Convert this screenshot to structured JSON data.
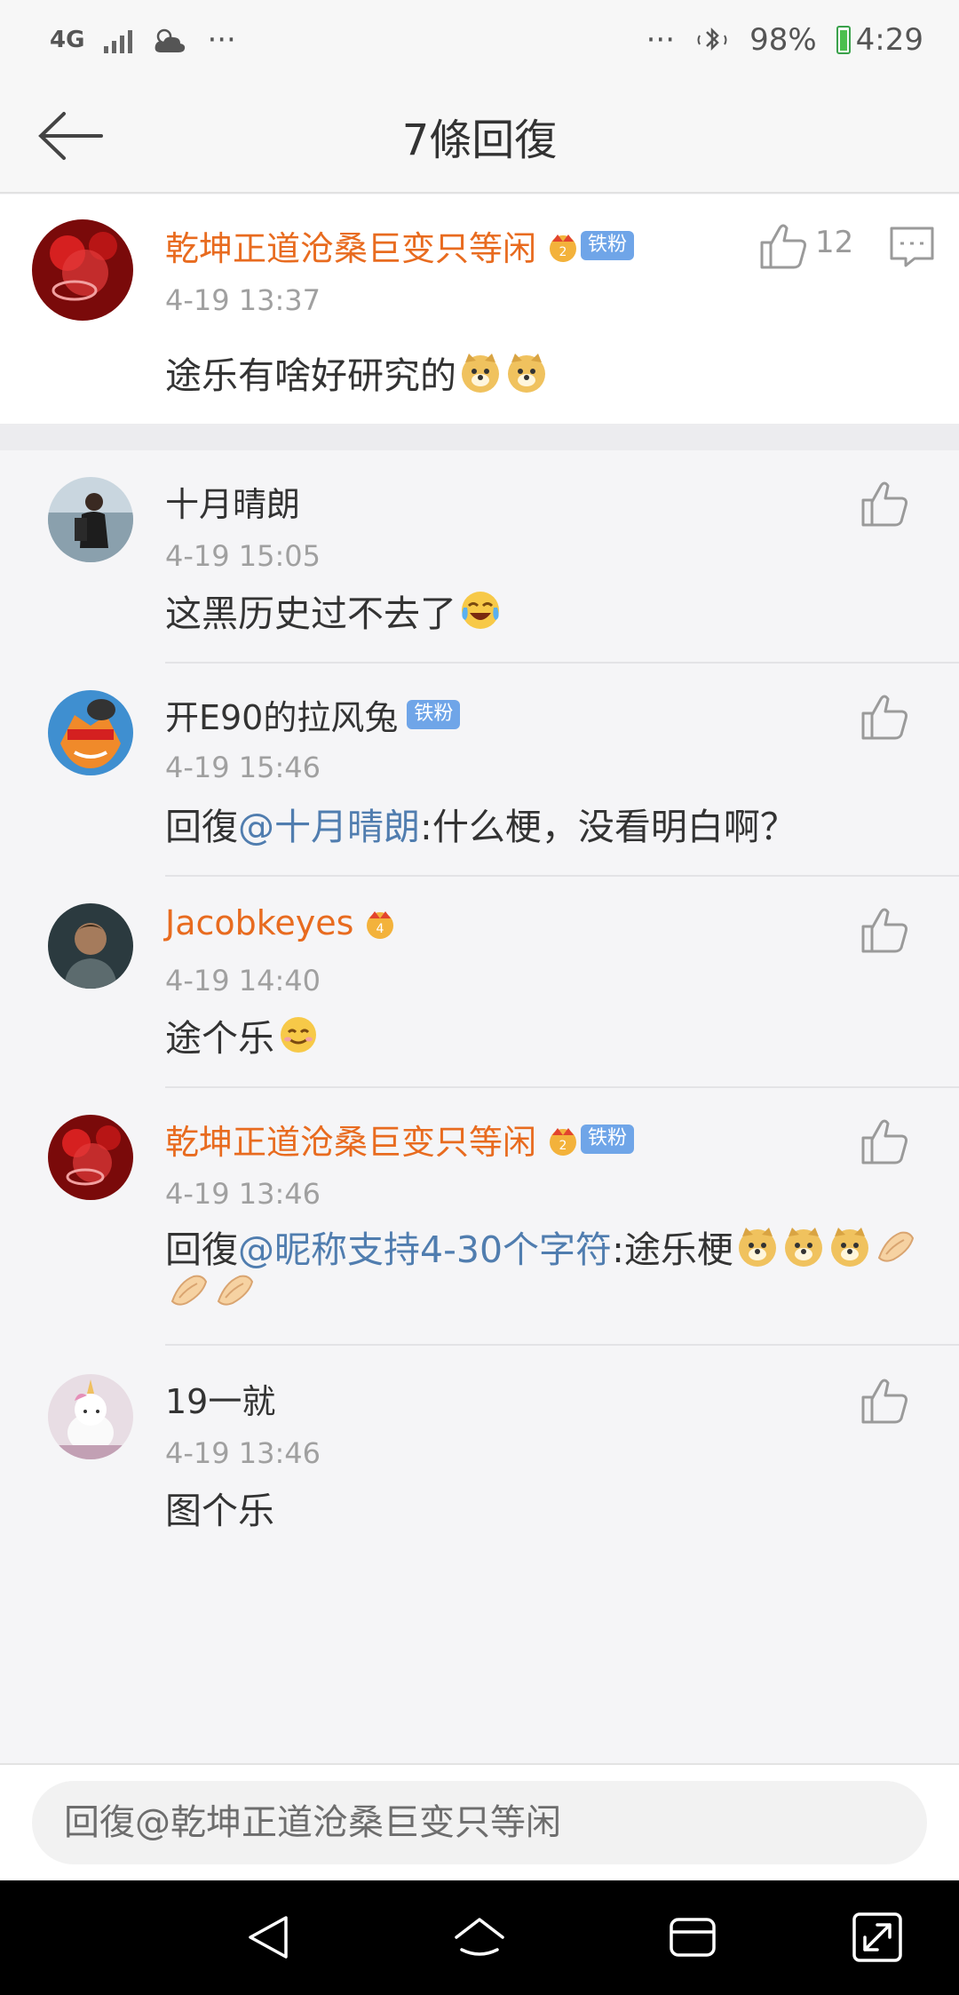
{
  "status_bar": {
    "network": "4G",
    "more_left": "···",
    "more_right": "···",
    "battery": "98%",
    "time": "4:29"
  },
  "nav": {
    "title": "7條回復"
  },
  "main_comment": {
    "user": "乾坤正道沧桑巨变只等闲",
    "badge": "铁粉",
    "time": "4-19 13:37",
    "text": "途乐有啥好研究的",
    "likes": "12"
  },
  "replies": [
    {
      "user": "十月晴朗",
      "time": "4-19 15:05",
      "text": "这黑历史过不去了"
    },
    {
      "user": "开E90的拉风兔",
      "badge": "铁粉",
      "time": "4-19 15:46",
      "prefix": "回復",
      "mention": "@十月晴朗",
      "text": ":什么梗，没看明白啊？"
    },
    {
      "user": "Jacobkeyes",
      "time": "4-19 14:40",
      "text": "途个乐"
    },
    {
      "user": "乾坤正道沧桑巨变只等闲",
      "badge": "铁粉",
      "time": "4-19 13:46",
      "prefix": "回復",
      "mention": "@昵称支持4-30个字符",
      "text": ":途乐梗"
    },
    {
      "user": "19一就",
      "time": "4-19 13:46",
      "text": "图个乐"
    }
  ],
  "input": {
    "placeholder": "回復@乾坤正道沧桑巨变只等闲"
  },
  "colors": {
    "vip_name": "#e86b1f",
    "mention": "#507daf",
    "badge": "#6fa5e8"
  }
}
